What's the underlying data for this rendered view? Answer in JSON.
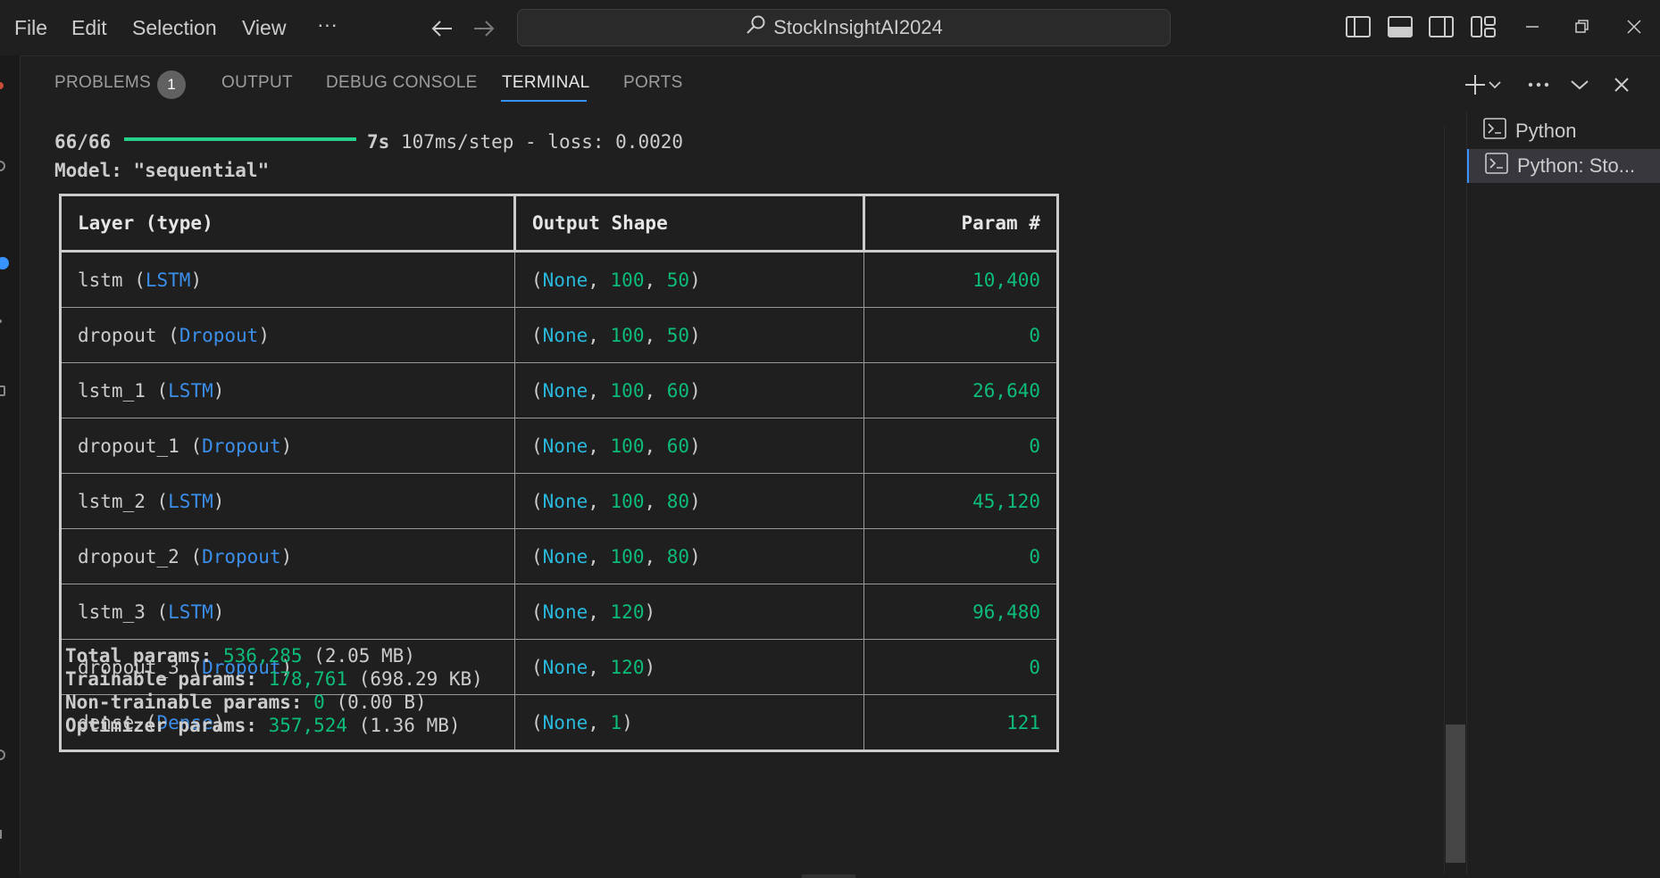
{
  "menu": [
    "File",
    "Edit",
    "Selection",
    "View",
    "···"
  ],
  "search": {
    "text": "StockInsightAI2024"
  },
  "panel": {
    "tabs": [
      "PROBLEMS",
      "OUTPUT",
      "DEBUG CONSOLE",
      "TERMINAL",
      "PORTS"
    ],
    "problems_badge": "1",
    "active_tab": "TERMINAL"
  },
  "terminal": {
    "progress_steps": "66/66",
    "progress_fraction": 1.0,
    "progress_time": "7s",
    "progress_rest": " 107ms/step - loss: 0.0020",
    "model_line": "Model: \"sequential\"",
    "table": {
      "headers": [
        "Layer (type)",
        "Output Shape",
        "Param #"
      ],
      "rows": [
        {
          "name": "lstm",
          "type": "LSTM",
          "shape": [
            "None",
            "100",
            "50"
          ],
          "params": "10,400"
        },
        {
          "name": "dropout",
          "type": "Dropout",
          "shape": [
            "None",
            "100",
            "50"
          ],
          "params": "0"
        },
        {
          "name": "lstm_1",
          "type": "LSTM",
          "shape": [
            "None",
            "100",
            "60"
          ],
          "params": "26,640"
        },
        {
          "name": "dropout_1",
          "type": "Dropout",
          "shape": [
            "None",
            "100",
            "60"
          ],
          "params": "0"
        },
        {
          "name": "lstm_2",
          "type": "LSTM",
          "shape": [
            "None",
            "100",
            "80"
          ],
          "params": "45,120"
        },
        {
          "name": "dropout_2",
          "type": "Dropout",
          "shape": [
            "None",
            "100",
            "80"
          ],
          "params": "0"
        },
        {
          "name": "lstm_3",
          "type": "LSTM",
          "shape": [
            "None",
            "120"
          ],
          "params": "96,480"
        },
        {
          "name": "dropout_3",
          "type": "Dropout",
          "shape": [
            "None",
            "120"
          ],
          "params": "0"
        },
        {
          "name": "dense",
          "type": "Dense",
          "shape": [
            "None",
            "1"
          ],
          "params": "121"
        }
      ]
    },
    "summary": [
      {
        "label": "Total params: ",
        "value": "536,285",
        "size": " (2.05 MB)"
      },
      {
        "label": "Trainable params: ",
        "value": "178,761",
        "size": " (698.29 KB)"
      },
      {
        "label": "Non-trainable params: ",
        "value": "0",
        "size": " (0.00 B)"
      },
      {
        "label": "Optimizer params: ",
        "value": "357,524",
        "size": " (1.36 MB)"
      }
    ]
  },
  "terminal_list": [
    "Python",
    "Python: Sto..."
  ],
  "colors": {
    "accent": "#3794ff",
    "green": "#0dbc79",
    "blue": "#3b8eea",
    "cyan": "#29b8db",
    "progress": "#23d18b"
  }
}
